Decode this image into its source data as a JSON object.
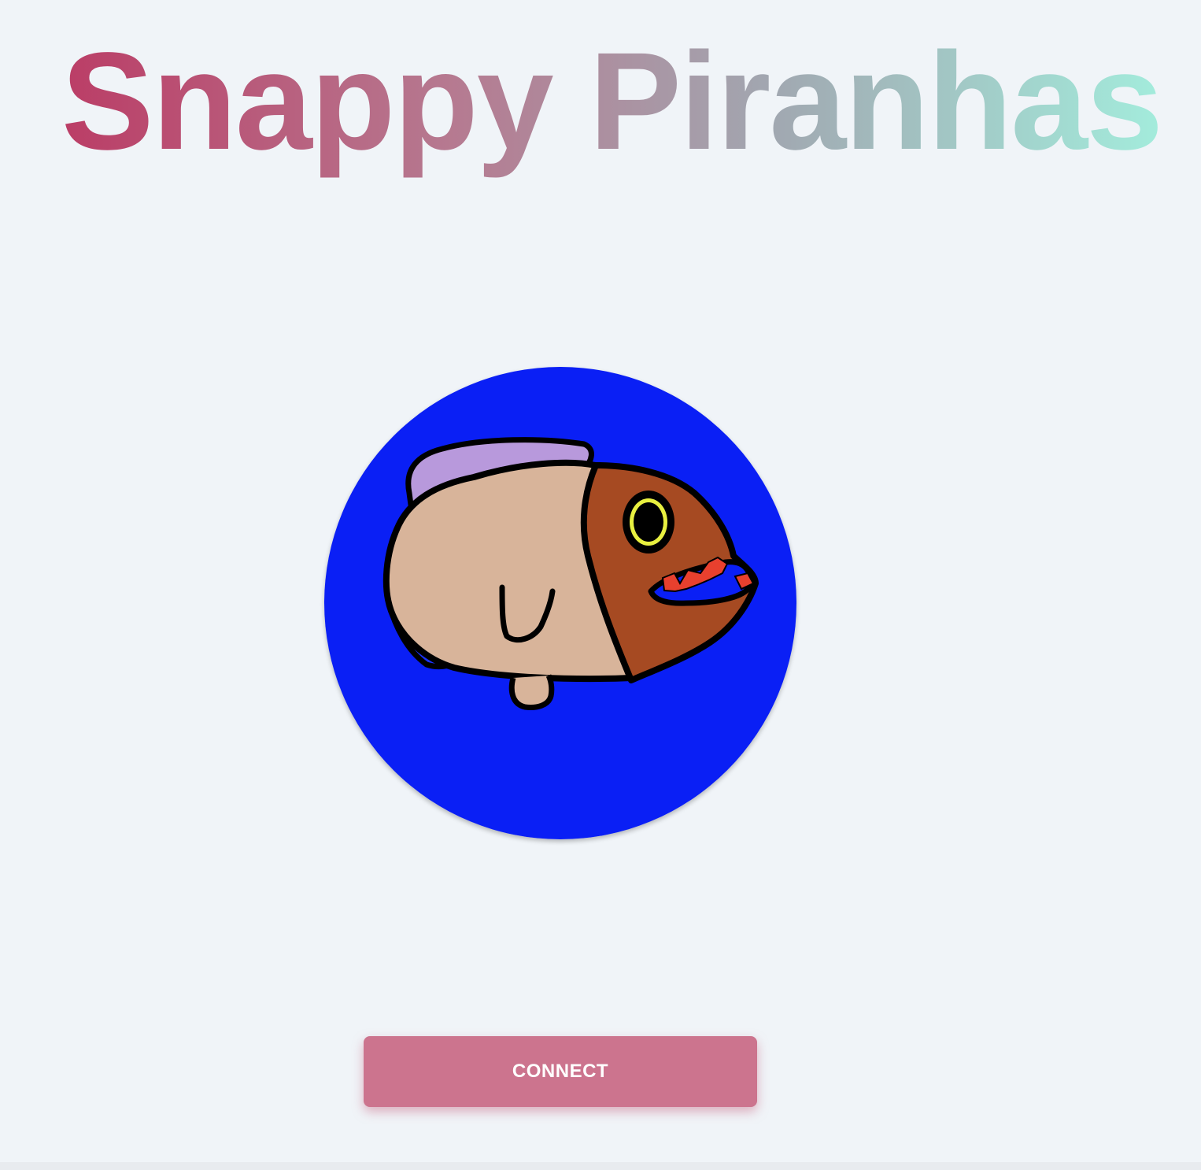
{
  "header": {
    "title": "Snappy Piranhas"
  },
  "hero": {
    "image_icon": "piranha-drawing-icon",
    "background_color": "#0a1ff5"
  },
  "actions": {
    "connect_label": "CONNECT"
  },
  "colors": {
    "page_background": "#f0f4f8",
    "button": "#cc748e",
    "title_gradient": [
      "#bb3d66",
      "#b67990",
      "#a1a8b1",
      "#a3ecdc"
    ]
  }
}
